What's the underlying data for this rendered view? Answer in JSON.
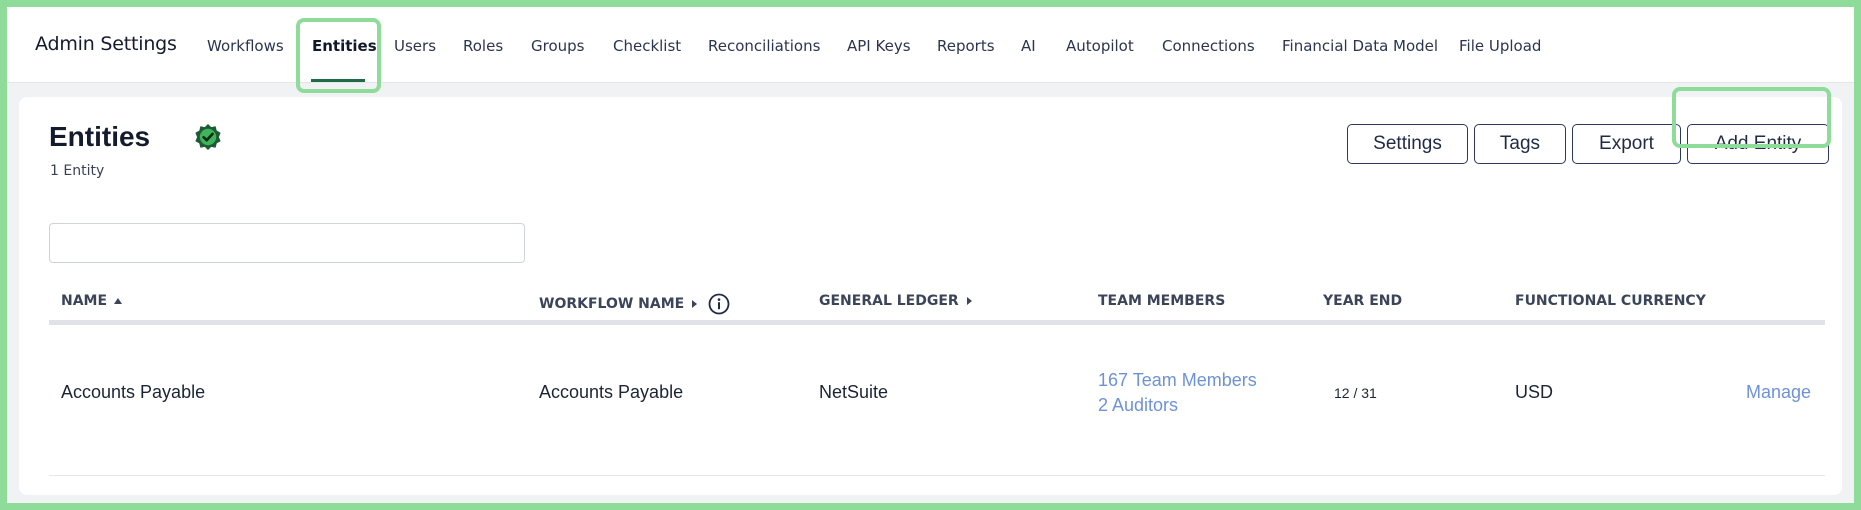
{
  "header": {
    "title": "Admin Settings",
    "tabs": [
      {
        "id": "workflows",
        "label": "Workflows"
      },
      {
        "id": "entities",
        "label": "Entities",
        "active": true
      },
      {
        "id": "users",
        "label": "Users"
      },
      {
        "id": "roles",
        "label": "Roles"
      },
      {
        "id": "groups",
        "label": "Groups"
      },
      {
        "id": "checklist",
        "label": "Checklist"
      },
      {
        "id": "reconciliations",
        "label": "Reconciliations"
      },
      {
        "id": "api-keys",
        "label": "API Keys"
      },
      {
        "id": "reports",
        "label": "Reports"
      },
      {
        "id": "ai",
        "label": "AI"
      },
      {
        "id": "autopilot",
        "label": "Autopilot"
      },
      {
        "id": "connections",
        "label": "Connections"
      },
      {
        "id": "financial-data-model",
        "label": "Financial Data Model"
      },
      {
        "id": "file-upload",
        "label": "File Upload"
      }
    ]
  },
  "page": {
    "title": "Entities",
    "count_label": "1 Entity",
    "verified_icon": "verified-badge-icon",
    "buttons": {
      "settings": "Settings",
      "tags": "Tags",
      "export": "Export",
      "add_entity": "Add Entity"
    },
    "search": {
      "value": "",
      "placeholder": ""
    }
  },
  "table": {
    "columns": {
      "name": "NAME",
      "workflow_name": "WORKFLOW NAME",
      "general_ledger": "GENERAL LEDGER",
      "team_members": "TEAM MEMBERS",
      "year_end": "YEAR END",
      "functional_currency": "FUNCTIONAL CURRENCY"
    },
    "rows": [
      {
        "name": "Accounts Payable",
        "workflow_name": "Accounts Payable",
        "general_ledger": "NetSuite",
        "team_members": "167 Team Members",
        "auditors": "2 Auditors",
        "year_end": "12 / 31",
        "functional_currency": "USD",
        "action": "Manage"
      }
    ]
  },
  "colors": {
    "highlight": "#8fdc9a",
    "active_underline": "#1f6b45",
    "link": "#6e92d6",
    "badge": "#1e5a35"
  }
}
